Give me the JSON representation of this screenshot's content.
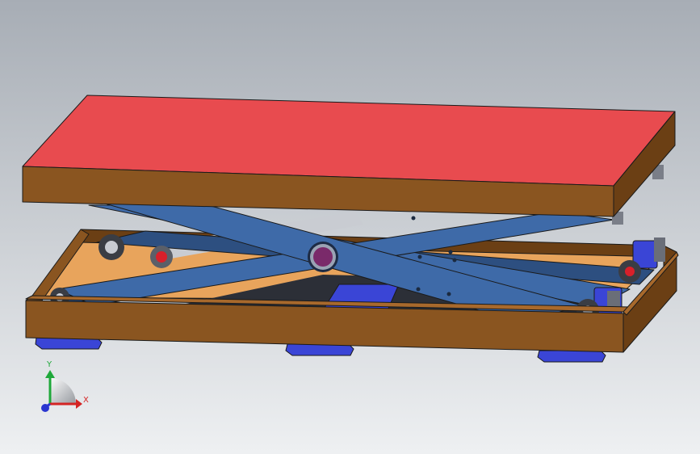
{
  "colors": {
    "background_top": "#a7adb5",
    "background_bottom": "#eef0f2",
    "platform_top": "#e84b4f",
    "platform_wood": "#8a5520",
    "platform_wood_dark": "#6b3f14",
    "base_wood": "#8a5520",
    "base_floor": "#e8a45c",
    "scissor_arm": "#3e6aa8",
    "scissor_arm_dark": "#2d4f80",
    "foot_pad": "#3a45d6",
    "pivot_pin": "#7a2a6a",
    "roller": "#c8cbd2",
    "axis_y": "#1fa83a",
    "axis_x": "#d42424",
    "axis_z": "#2a36d0"
  },
  "axes": {
    "y_label": "Y",
    "x_label": "X"
  }
}
